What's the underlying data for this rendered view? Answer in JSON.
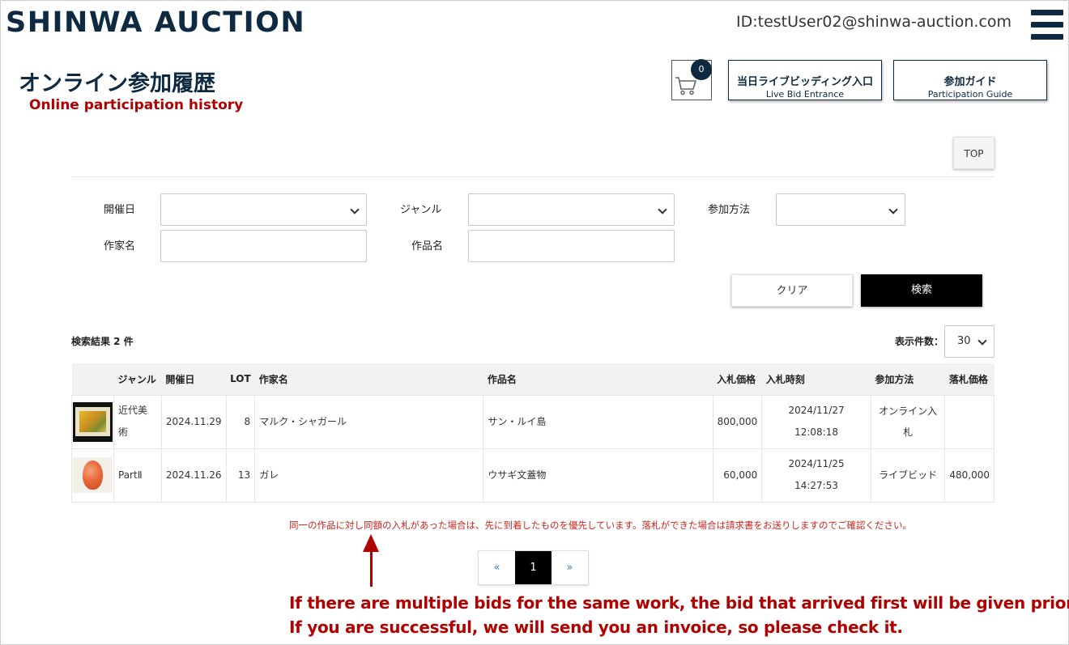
{
  "header": {
    "logo": "SHINWA AUCTION",
    "user_id": "ID:testUser02@shinwa-auction.com"
  },
  "page": {
    "title": "オンライン参加履歴",
    "annotation_title_en": "Online participation history"
  },
  "cart": {
    "count": "0"
  },
  "buttons": {
    "live_bid_jp": "当日ライブビッディング入口",
    "live_bid_en": "Live Bid Entrance",
    "guide_jp": "参加ガイド",
    "guide_en": "Participation Guide",
    "top": "TOP",
    "clear": "クリア",
    "search": "検索"
  },
  "filters": {
    "date_label": "開催日",
    "genre_label": "ジャンル",
    "method_label": "参加方法",
    "artist_label": "作家名",
    "work_label": "作品名"
  },
  "results": {
    "count_text": "検索結果 2 件",
    "perpage_label": "表示件数：",
    "perpage_value": "30",
    "headers": [
      "",
      "ジャンル",
      "開催日",
      "LOT",
      "作家名",
      "作品名",
      "入札価格",
      "入札時刻",
      "参加方法",
      "落札価格"
    ],
    "rows": [
      {
        "genre": "近代美術",
        "date": "2024.11.29",
        "lot": "8",
        "artist": "マルク・シャガール",
        "work": "サン・ルイ島",
        "bid_price": "800,000",
        "bid_date": "2024/11/27",
        "bid_time": "12:08:18",
        "method": "オンライン入札",
        "hammer_price": ""
      },
      {
        "genre": "PartⅡ",
        "date": "2024.11.26",
        "lot": "13",
        "artist": "ガレ",
        "work": "ウサギ文蓋物",
        "bid_price": "60,000",
        "bid_date": "2024/11/25",
        "bid_time": "14:27:53",
        "method": "ライブビッド",
        "hammer_price": "480,000"
      }
    ]
  },
  "notice": "同一の作品に対し同額の入札があった場合は、先に到着したものを優先しています。落札ができた場合は請求書をお送りしますのでご確認ください。",
  "pagination": {
    "prev": "«",
    "current": "1",
    "next": "»"
  },
  "annotation_en": {
    "line1": "If there are multiple bids for the same work, the bid that arrived first will be given priority.",
    "line2": "If you are successful, we will send you an invoice, so please check it."
  },
  "colors": {
    "brand_navy": "#0d2a42",
    "annotation_red": "#b00000",
    "notice_red": "#c9271f"
  }
}
